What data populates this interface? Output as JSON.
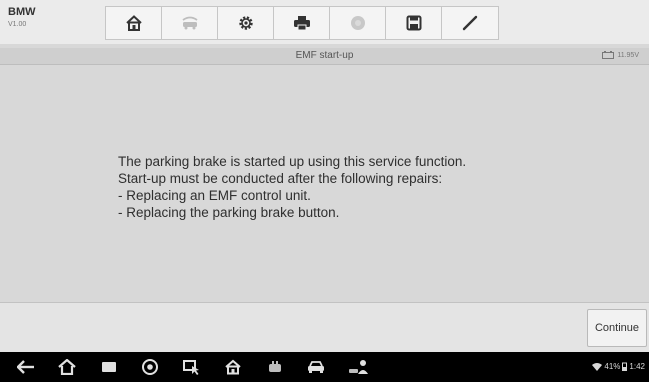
{
  "app": {
    "brand": "BMW",
    "version": "V1.00"
  },
  "toolbar": {
    "buttons": [
      {
        "icon": "home-icon",
        "enabled": true
      },
      {
        "icon": "vehicle-swap-icon",
        "enabled": false
      },
      {
        "icon": "gear-icon",
        "enabled": true
      },
      {
        "icon": "printer-icon",
        "enabled": true
      },
      {
        "icon": "help-icon",
        "enabled": false
      },
      {
        "icon": "save-icon",
        "enabled": true
      },
      {
        "icon": "pen-icon",
        "enabled": true
      }
    ]
  },
  "titlebar": {
    "title": "EMF start-up",
    "voltage": "11.95V"
  },
  "message": {
    "lines": [
      "The parking brake is started up using this service function.",
      "Start-up must be conducted after the following repairs:",
      "- Replacing an EMF control unit.",
      "- Replacing the parking brake button."
    ]
  },
  "bottom": {
    "continue_label": "Continue"
  },
  "status": {
    "battery": "41%",
    "time": "1:42"
  },
  "colors": {
    "background": "#d8d8d8",
    "toolbar": "#ebebeb",
    "navbar": "#000000",
    "icon_dark": "#333333",
    "icon_disabled": "#bdbdbd"
  }
}
